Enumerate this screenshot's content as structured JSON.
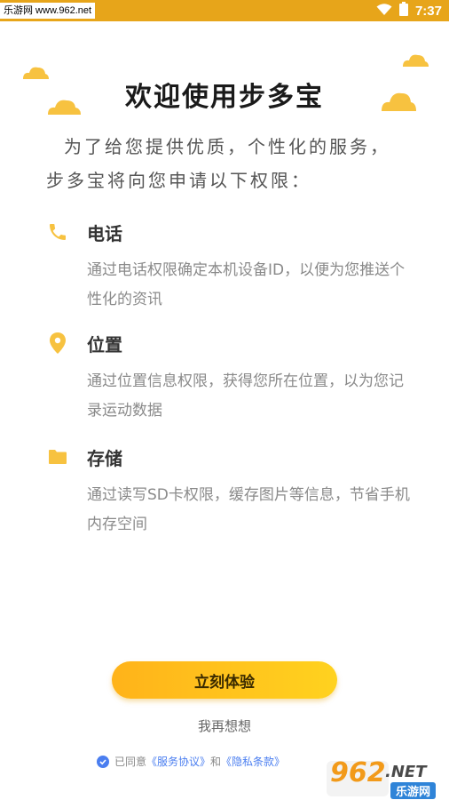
{
  "status_bar": {
    "watermark": "乐游网 www.962.net",
    "time": "7:37"
  },
  "title": "欢迎使用步多宝",
  "intro": "为了给您提供优质，个性化的服务，步多宝将向您申请以下权限：",
  "permissions": [
    {
      "icon": "phone-icon",
      "title": "电话",
      "desc": "通过电话权限确定本机设备ID，以便为您推送个性化的资讯"
    },
    {
      "icon": "location-pin-icon",
      "title": "位置",
      "desc": "通过位置信息权限，获得您所在位置，以为您记录运动数据"
    },
    {
      "icon": "folder-icon",
      "title": "存储",
      "desc": "通过读写SD卡权限，缓存图片等信息，节省手机内存空间"
    }
  ],
  "cta": "立刻体验",
  "later": "我再想想",
  "agreement": {
    "prefix": "已同意",
    "service": "《服务协议》",
    "and": "和",
    "privacy": "《隐私条款》"
  },
  "logo": {
    "big": "962",
    "small": ".NET",
    "sub": "乐游网"
  },
  "colors": {
    "accent": "#ffc21a",
    "status_bar": "#e7a51a",
    "link": "#4a7ef0"
  }
}
